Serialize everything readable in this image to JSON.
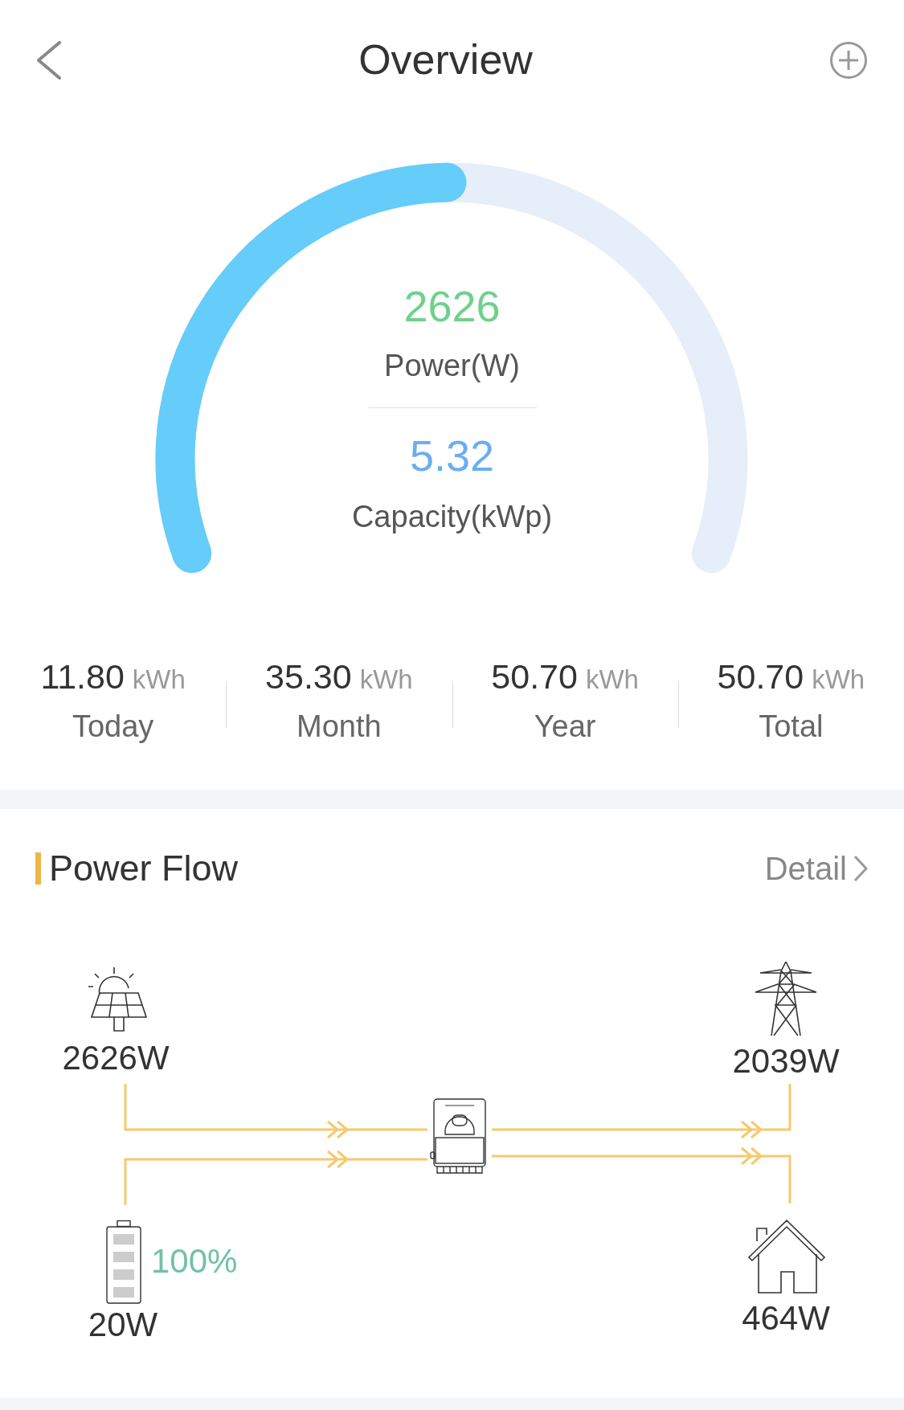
{
  "header": {
    "title": "Overview"
  },
  "gauge": {
    "power": "2626",
    "power_label": "Power(W)",
    "capacity": "5.32",
    "capacity_label": "Capacity(kWp)"
  },
  "stats": [
    {
      "value": "11.80",
      "unit": "kWh",
      "label": "Today"
    },
    {
      "value": "35.30",
      "unit": "kWh",
      "label": "Month"
    },
    {
      "value": "50.70",
      "unit": "kWh",
      "label": "Year"
    },
    {
      "value": "50.70",
      "unit": "kWh",
      "label": "Total"
    }
  ],
  "power_flow": {
    "title": "Power Flow",
    "detail": "Detail",
    "solar": {
      "reading": "2626W"
    },
    "grid": {
      "reading": "2039W"
    },
    "battery": {
      "reading": "20W",
      "charge": "100%"
    },
    "home": {
      "reading": "464W"
    }
  }
}
